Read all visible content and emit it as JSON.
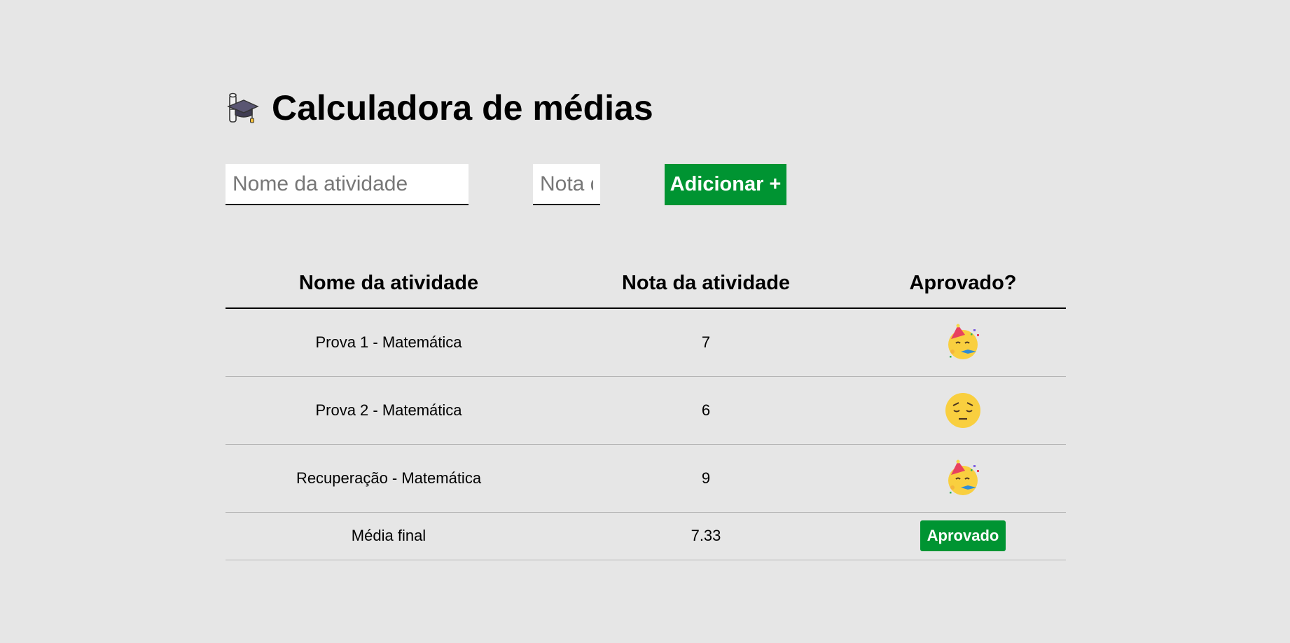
{
  "header": {
    "title": "Calculadora de médias",
    "icon": "graduation-cap-icon"
  },
  "form": {
    "activity_name": {
      "placeholder": "Nome da atividade",
      "value": ""
    },
    "grade": {
      "placeholder": "Nota da atividade",
      "value": ""
    },
    "add_label": "Adicionar +"
  },
  "table": {
    "headers": [
      "Nome da atividade",
      "Nota da atividade",
      "Aprovado?"
    ],
    "rows": [
      {
        "name": "Prova 1 - Matemática",
        "grade": "7",
        "status_icon": "party-face-icon"
      },
      {
        "name": "Prova 2 - Matemática",
        "grade": "6",
        "status_icon": "pensive-face-icon"
      },
      {
        "name": "Recuperação - Matemática",
        "grade": "9",
        "status_icon": "party-face-icon"
      }
    ],
    "final": {
      "label": "Média final",
      "value": "7.33",
      "status": "Aprovado"
    }
  },
  "colors": {
    "background": "#e6e6e6",
    "accent_green": "#009432"
  }
}
